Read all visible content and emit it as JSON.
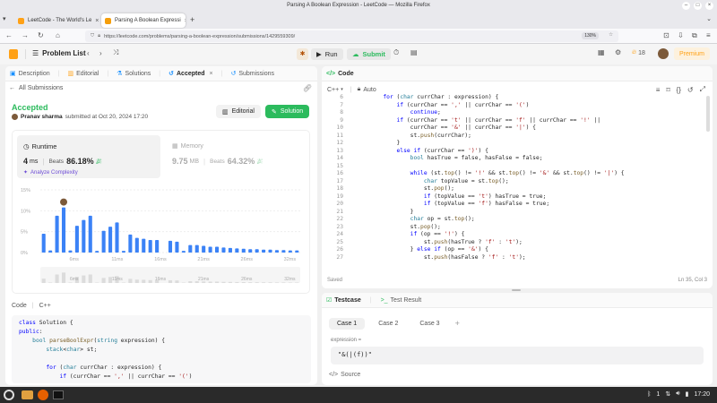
{
  "window": {
    "title": "Parsing A Boolean Expression - LeetCode — Mozilla Firefox"
  },
  "tabs": [
    {
      "label": "LeetCode - The World's Le",
      "color": "#ffa116",
      "active": false
    },
    {
      "label": "Parsing A Boolean Expressi",
      "color": "#f59e0b",
      "active": true
    }
  ],
  "nav": {
    "url": "https://leetcode.com/problems/parsing-a-boolean-expression/submissions/1429559309/",
    "zoom": "130%"
  },
  "header": {
    "problem_list": "Problem List",
    "run": "Run",
    "submit": "Submit",
    "streak": "18",
    "premium": "Premium"
  },
  "left_tabs": {
    "description": "Description",
    "editorial": "Editorial",
    "solutions": "Solutions",
    "accepted": "Accepted",
    "submissions": "Submissions"
  },
  "submission": {
    "back": "All Submissions",
    "status": "Accepted",
    "user": "Pranav sharma",
    "submitted_at": "submitted at Oct 20, 2024 17:20",
    "editorial_btn": "Editorial",
    "solution_btn": "Solution"
  },
  "runtime": {
    "label": "Runtime",
    "value": "4",
    "unit": "ms",
    "beats_label": "Beats",
    "beats": "86.18%",
    "analyze": "Analyze Complexity"
  },
  "memory": {
    "label": "Memory",
    "value": "9.75",
    "unit": "MB",
    "beats_label": "Beats",
    "beats": "64.32%"
  },
  "chart_data": {
    "type": "bar",
    "title": "",
    "xlabel": "",
    "ylabel": "",
    "ylim": [
      0,
      15
    ],
    "yticks": [
      "15%",
      "10%",
      "5%",
      "0%"
    ],
    "xticks": [
      "6ms",
      "11ms",
      "16ms",
      "21ms",
      "26ms",
      "32ms"
    ],
    "values": [
      4.5,
      0.5,
      8.8,
      10.8,
      0.5,
      6.4,
      7.8,
      8.8,
      0.4,
      5.2,
      6.2,
      7.2,
      0.4,
      4.3,
      3.5,
      3.3,
      3.0,
      3.0,
      0,
      2.8,
      2.6,
      0.4,
      1.8,
      1.8,
      1.6,
      1.4,
      1.4,
      1.2,
      1.1,
      1.0,
      0.9,
      0.8,
      0.8,
      0.7,
      0.7,
      0.6,
      0.6,
      0.5,
      0.5
    ],
    "highlight_index": 3,
    "bar_color": "#3b82f6"
  },
  "code_section": {
    "label": "Code",
    "lang": "C++",
    "lines": [
      "class Solution {",
      "public:",
      "    bool parseBoolExpr(string expression) {",
      "        stack<char> st;",
      "",
      "        for (char currChar : expression) {",
      "            if (currChar == ',' || currChar == '(')"
    ]
  },
  "editor": {
    "title": "Code",
    "lang": "C++",
    "mode": "Auto",
    "saved": "Saved",
    "cursor": "Ln 35, Col 3",
    "start_line": 6,
    "lines": [
      "        for (char currChar : expression) {",
      "            if (currChar == ',' || currChar == '(')",
      "                continue;",
      "            if (currChar == 't' || currChar == 'f' || currChar == '!' ||",
      "                currChar == '&' || currChar == '|') {",
      "                st.push(currChar);",
      "            }",
      "            else if (currChar == ')') {",
      "                bool hasTrue = false, hasFalse = false;",
      "",
      "                while (st.top() != '!' && st.top() != '&' && st.top() != '|') {",
      "                    char topValue = st.top();",
      "                    st.pop();",
      "                    if (topValue == 't') hasTrue = true;",
      "                    if (topValue == 'f') hasFalse = true;",
      "                }",
      "                char op = st.top();",
      "                st.pop();",
      "                if (op == '!') {",
      "                    st.push(hasTrue ? 'f' : 't');",
      "                } else if (op == '&') {",
      "                    st.push(hasFalse ? 'f' : 't');"
    ]
  },
  "testcase": {
    "tab": "Testcase",
    "result_tab": "Test Result",
    "cases": [
      "Case 1",
      "Case 2",
      "Case 3"
    ],
    "add": "+",
    "param_label": "expression =",
    "param_value": "\"&(|(f))\"",
    "source": "Source"
  },
  "taskbar": {
    "time": "17:20",
    "tray_num": "1"
  }
}
